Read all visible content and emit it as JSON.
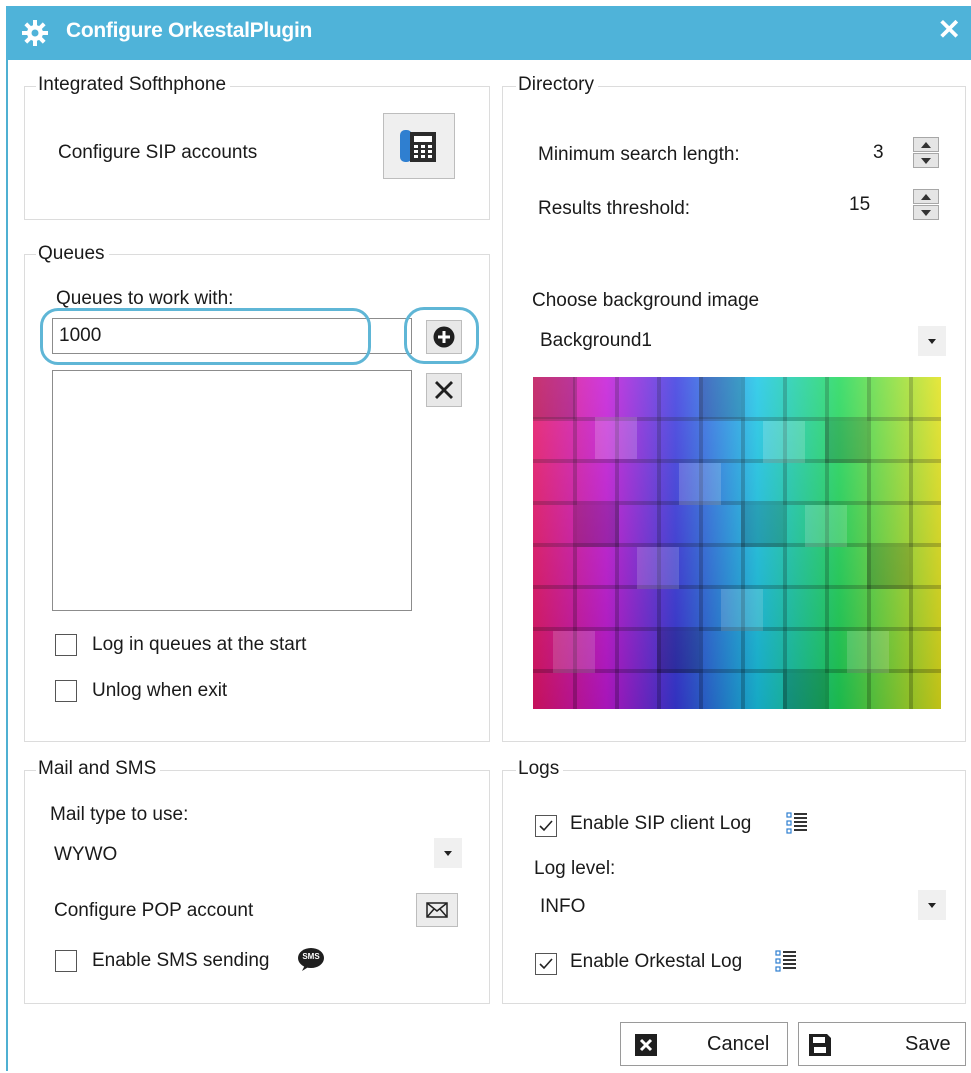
{
  "window": {
    "title": "Configure OrkestalPlugin",
    "accent": "#4fb3d9"
  },
  "softphone": {
    "legend": "Integrated Softhphone",
    "configure_label": "Configure SIP accounts"
  },
  "queues": {
    "legend": "Queues",
    "work_label": "Queues to work with:",
    "input_value": "1000",
    "login_label": "Log in queues at the start",
    "unlog_label": "Unlog when exit"
  },
  "directory": {
    "legend": "Directory",
    "min_search_label": "Minimum search length:",
    "min_search_value": "3",
    "results_label": "Results threshold:",
    "results_value": "15",
    "bg_label": "Choose background image",
    "bg_value": "Background1"
  },
  "mail": {
    "legend": "Mail and SMS",
    "type_label": "Mail type to use:",
    "type_value": "WYWO",
    "pop_label": "Configure POP account",
    "sms_label": "Enable SMS sending",
    "sms_badge": "SMS"
  },
  "logs": {
    "legend": "Logs",
    "sip_log_label": "Enable SIP client Log",
    "level_label": "Log level:",
    "level_value": "INFO",
    "orkestal_log_label": "Enable Orkestal Log"
  },
  "footer": {
    "cancel_label": "Cancel",
    "save_label": "Save"
  }
}
